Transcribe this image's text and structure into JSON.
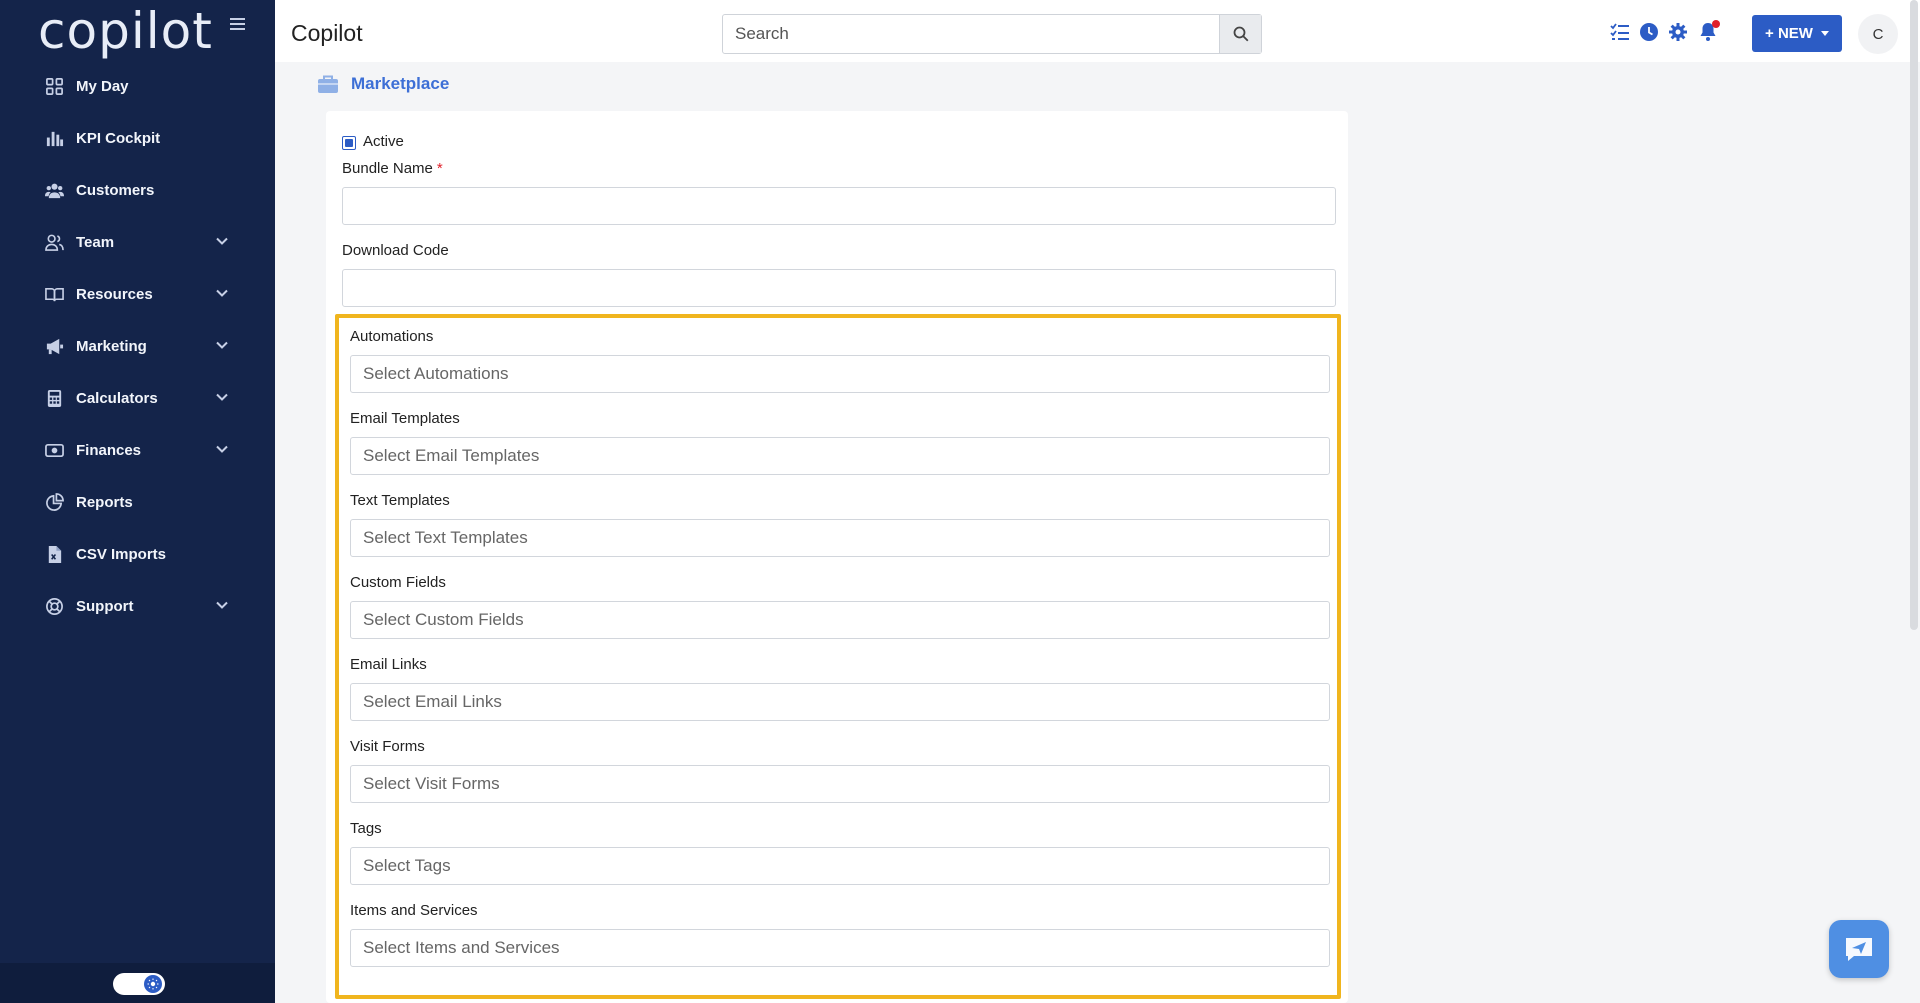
{
  "sidebar": {
    "logo": "copilot",
    "items": [
      {
        "label": "My Day",
        "icon": "grid-icon",
        "expandable": false
      },
      {
        "label": "KPI Cockpit",
        "icon": "bar-chart-icon",
        "expandable": false
      },
      {
        "label": "Customers",
        "icon": "users-icon",
        "expandable": false
      },
      {
        "label": "Team",
        "icon": "user-group-icon",
        "expandable": true
      },
      {
        "label": "Resources",
        "icon": "book-icon",
        "expandable": true
      },
      {
        "label": "Marketing",
        "icon": "megaphone-icon",
        "expandable": true
      },
      {
        "label": "Calculators",
        "icon": "calculator-icon",
        "expandable": true
      },
      {
        "label": "Finances",
        "icon": "money-icon",
        "expandable": true
      },
      {
        "label": "Reports",
        "icon": "pie-chart-icon",
        "expandable": false
      },
      {
        "label": "CSV Imports",
        "icon": "file-csv-icon",
        "expandable": false
      },
      {
        "label": "Support",
        "icon": "lifebuoy-icon",
        "expandable": true
      }
    ]
  },
  "header": {
    "title": "Copilot",
    "search_placeholder": "Search",
    "new_label": "+ NEW",
    "avatar_initial": "C"
  },
  "breadcrumb": {
    "label": "Marketplace"
  },
  "form": {
    "active_label": "Active",
    "active_checked": true,
    "bundle_name_label": "Bundle Name",
    "required_mark": "*",
    "bundle_name_value": "",
    "download_code_label": "Download Code",
    "download_code_value": "",
    "selects": [
      {
        "label": "Automations",
        "placeholder": "Select Automations"
      },
      {
        "label": "Email Templates",
        "placeholder": "Select Email Templates"
      },
      {
        "label": "Text Templates",
        "placeholder": "Select Text Templates"
      },
      {
        "label": "Custom Fields",
        "placeholder": "Select Custom Fields"
      },
      {
        "label": "Email Links",
        "placeholder": "Select Email Links"
      },
      {
        "label": "Visit Forms",
        "placeholder": "Select Visit Forms"
      },
      {
        "label": "Tags",
        "placeholder": "Select Tags"
      },
      {
        "label": "Items and Services",
        "placeholder": "Select Items and Services"
      }
    ]
  },
  "colors": {
    "sidebar_bg": "#14244a",
    "accent": "#2c5cc5",
    "highlight_border": "#f0b51e",
    "notification": "#e0202a"
  }
}
